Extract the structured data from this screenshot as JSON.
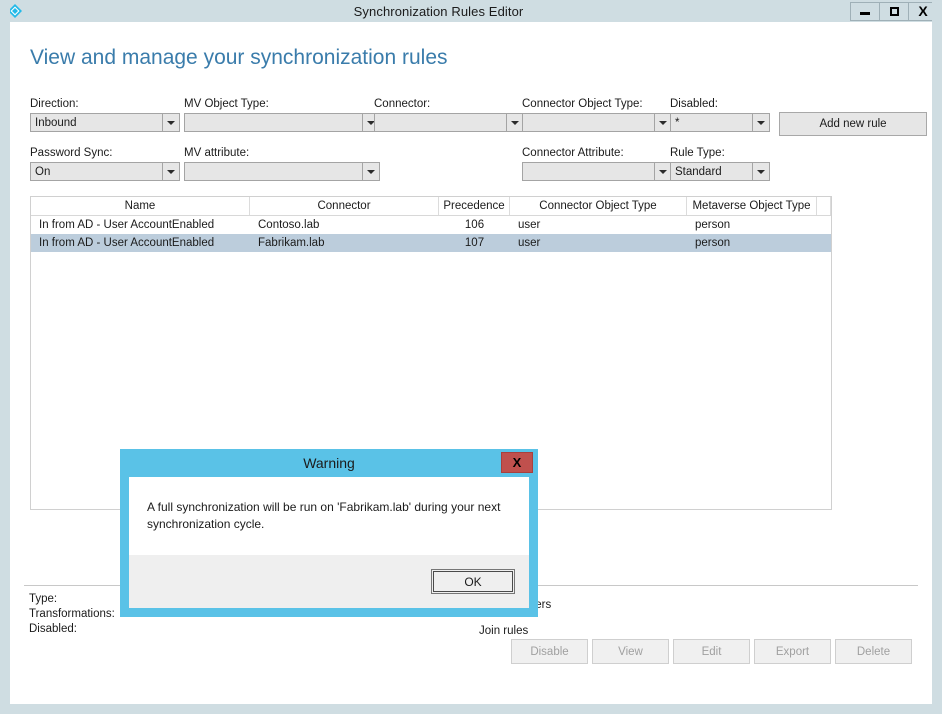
{
  "window": {
    "title": "Synchronization Rules Editor",
    "icon": "sync-rules-editor-icon",
    "minimize_label": "–",
    "maximize_label": "☐",
    "close_label": "X"
  },
  "page": {
    "heading": "View and manage your synchronization rules"
  },
  "filters": {
    "direction": {
      "label": "Direction:",
      "value": "Inbound"
    },
    "mv_object_type": {
      "label": "MV Object Type:",
      "value": ""
    },
    "connector": {
      "label": "Connector:",
      "value": ""
    },
    "connector_object_type": {
      "label": "Connector Object Type:",
      "value": ""
    },
    "disabled": {
      "label": "Disabled:",
      "value": "*"
    },
    "password_sync": {
      "label": "Password Sync:",
      "value": "On"
    },
    "mv_attribute": {
      "label": "MV attribute:",
      "value": ""
    },
    "connector_attribute": {
      "label": "Connector Attribute:",
      "value": ""
    },
    "rule_type": {
      "label": "Rule Type:",
      "value": "Standard"
    },
    "add_new_rule": "Add new rule"
  },
  "grid": {
    "columns": [
      "Name",
      "Connector",
      "Precedence",
      "Connector Object Type",
      "Metaverse Object Type"
    ],
    "rows": [
      {
        "name": "In from AD - User AccountEnabled",
        "connector": "Contoso.lab",
        "precedence": "106",
        "connector_object_type": "user",
        "metaverse_object_type": "person",
        "selected": false
      },
      {
        "name": "In from AD - User AccountEnabled",
        "connector": "Fabrikam.lab",
        "precedence": "107",
        "connector_object_type": "user",
        "metaverse_object_type": "person",
        "selected": true
      }
    ]
  },
  "detail": {
    "type_label": "Type:",
    "transformations_label": "Transformations:",
    "disabled_label": "Disabled:",
    "scoping_filters_label": "Scoping filters",
    "join_rules_label": "Join rules"
  },
  "actions": {
    "disable": "Disable",
    "view": "View",
    "edit": "Edit",
    "export": "Export",
    "delete": "Delete"
  },
  "dialog": {
    "title": "Warning",
    "close_label": "X",
    "message": "A full synchronization will be run on 'Fabrikam.lab' during your next synchronization cycle.",
    "ok_label": "OK",
    "accent_color": "#5ac2e7",
    "close_color": "#c0504d"
  }
}
